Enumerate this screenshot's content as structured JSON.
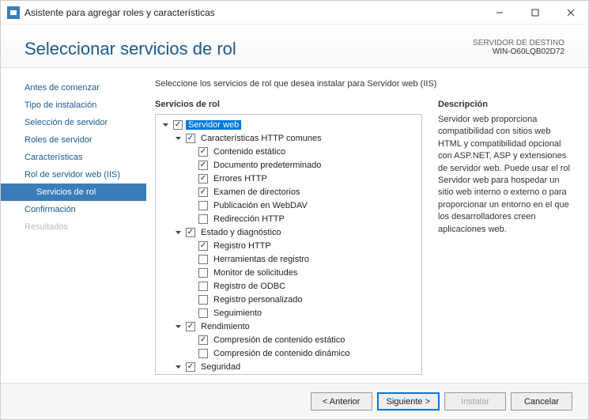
{
  "window": {
    "title": "Asistente para agregar roles y características"
  },
  "header": {
    "page_title": "Seleccionar servicios de rol",
    "dest_label": "SERVIDOR DE DESTINO",
    "dest_server": "WIN-O60LQB02D72"
  },
  "nav": {
    "items": [
      {
        "label": "Antes de comenzar",
        "state": "link"
      },
      {
        "label": "Tipo de instalación",
        "state": "link"
      },
      {
        "label": "Selección de servidor",
        "state": "link"
      },
      {
        "label": "Roles de servidor",
        "state": "link"
      },
      {
        "label": "Características",
        "state": "link"
      },
      {
        "label": "Rol de servidor web (IIS)",
        "state": "link"
      },
      {
        "label": "Servicios de rol",
        "state": "selected",
        "sub": true
      },
      {
        "label": "Confirmación",
        "state": "link"
      },
      {
        "label": "Resultados",
        "state": "disabled"
      }
    ]
  },
  "main": {
    "instruction": "Seleccione los servicios de rol que desea instalar para Servidor web (IIS)",
    "roles_title": "Servicios de rol",
    "desc_title": "Descripción",
    "description": "Servidor web proporciona compatibilidad con sitios web HTML y compatibilidad opcional con ASP.NET, ASP y extensiones de servidor web. Puede usar el rol Servidor web para hospedar un sitio web interno o externo o para proporcionar un entorno en el que los desarrolladores creen aplicaciones web."
  },
  "tree": {
    "root": {
      "label": "Servidor web",
      "checked": true,
      "highlighted": true,
      "expanded": true,
      "children": [
        {
          "label": "Características HTTP comunes",
          "checked": true,
          "expanded": true,
          "children": [
            {
              "label": "Contenido estático",
              "checked": true
            },
            {
              "label": "Documento predeterminado",
              "checked": true
            },
            {
              "label": "Errores HTTP",
              "checked": true
            },
            {
              "label": "Examen de directorios",
              "checked": true
            },
            {
              "label": "Publicación en WebDAV",
              "checked": false
            },
            {
              "label": "Redirección HTTP",
              "checked": false
            }
          ]
        },
        {
          "label": "Estado y diagnóstico",
          "checked": true,
          "expanded": true,
          "children": [
            {
              "label": "Registro HTTP",
              "checked": true
            },
            {
              "label": "Herramientas de registro",
              "checked": false
            },
            {
              "label": "Monitor de solicitudes",
              "checked": false
            },
            {
              "label": "Registro de ODBC",
              "checked": false
            },
            {
              "label": "Registro personalizado",
              "checked": false
            },
            {
              "label": "Seguimiento",
              "checked": false
            }
          ]
        },
        {
          "label": "Rendimiento",
          "checked": true,
          "expanded": true,
          "children": [
            {
              "label": "Compresión de contenido estático",
              "checked": true
            },
            {
              "label": "Compresión de contenido dinámico",
              "checked": false
            }
          ]
        },
        {
          "label": "Seguridad",
          "checked": true,
          "expanded": true,
          "children": []
        }
      ]
    }
  },
  "footer": {
    "prev": "< Anterior",
    "next": "Siguiente >",
    "install": "Instalar",
    "cancel": "Cancelar"
  }
}
